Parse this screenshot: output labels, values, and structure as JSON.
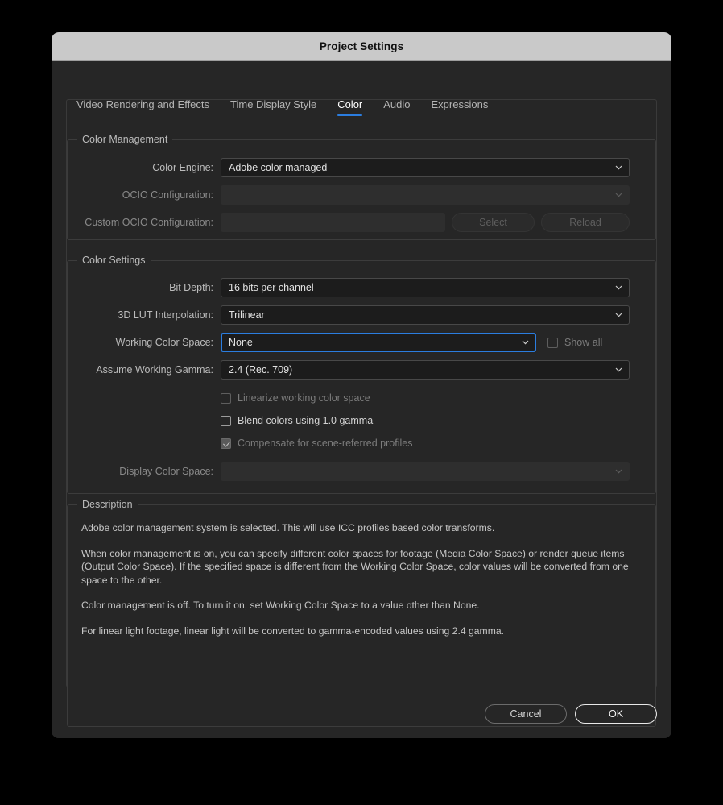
{
  "window": {
    "title": "Project Settings"
  },
  "tabs": [
    {
      "label": "Video Rendering and Effects",
      "active": false
    },
    {
      "label": "Time Display Style",
      "active": false
    },
    {
      "label": "Color",
      "active": true
    },
    {
      "label": "Audio",
      "active": false
    },
    {
      "label": "Expressions",
      "active": false
    }
  ],
  "color_management": {
    "legend": "Color Management",
    "color_engine": {
      "label": "Color Engine:",
      "value": "Adobe color managed"
    },
    "ocio_configuration": {
      "label": "OCIO Configuration:",
      "value": ""
    },
    "custom_ocio_configuration": {
      "label": "Custom OCIO Configuration:",
      "value": "",
      "select_button": "Select",
      "reload_button": "Reload"
    }
  },
  "color_settings": {
    "legend": "Color Settings",
    "bit_depth": {
      "label": "Bit Depth:",
      "value": "16 bits per channel"
    },
    "lut_interpolation": {
      "label": "3D LUT Interpolation:",
      "value": "Trilinear"
    },
    "working_color_space": {
      "label": "Working Color Space:",
      "value": "None"
    },
    "show_all": {
      "label": "Show all",
      "checked": false
    },
    "assume_working_gamma": {
      "label": "Assume Working Gamma:",
      "value": "2.4 (Rec. 709)"
    },
    "linearize": {
      "label": "Linearize working color space",
      "checked": false
    },
    "blend_1_gamma": {
      "label": "Blend colors using 1.0 gamma",
      "checked": false
    },
    "compensate": {
      "label": "Compensate for scene-referred profiles",
      "checked": true
    },
    "display_color_space": {
      "label": "Display Color Space:",
      "value": ""
    }
  },
  "description": {
    "legend": "Description",
    "paragraphs": [
      "Adobe color management system is selected. This will use ICC profiles based color transforms.",
      "When color management is on, you can specify different color spaces for footage (Media Color Space) or render queue items (Output Color Space). If the specified space is different from the Working Color Space, color values will be converted from one space to the other.",
      "Color management is off. To turn it on, set Working Color Space to a value other than None.",
      "For linear light footage, linear light will be converted to gamma-encoded values using 2.4 gamma."
    ]
  },
  "footer": {
    "cancel": "Cancel",
    "ok": "OK"
  },
  "colors": {
    "accent_blue": "#2b7ddf",
    "titlebar": "#c9c9c9",
    "dialog_bg": "#262626",
    "field_bg": "#1c1c1c"
  }
}
